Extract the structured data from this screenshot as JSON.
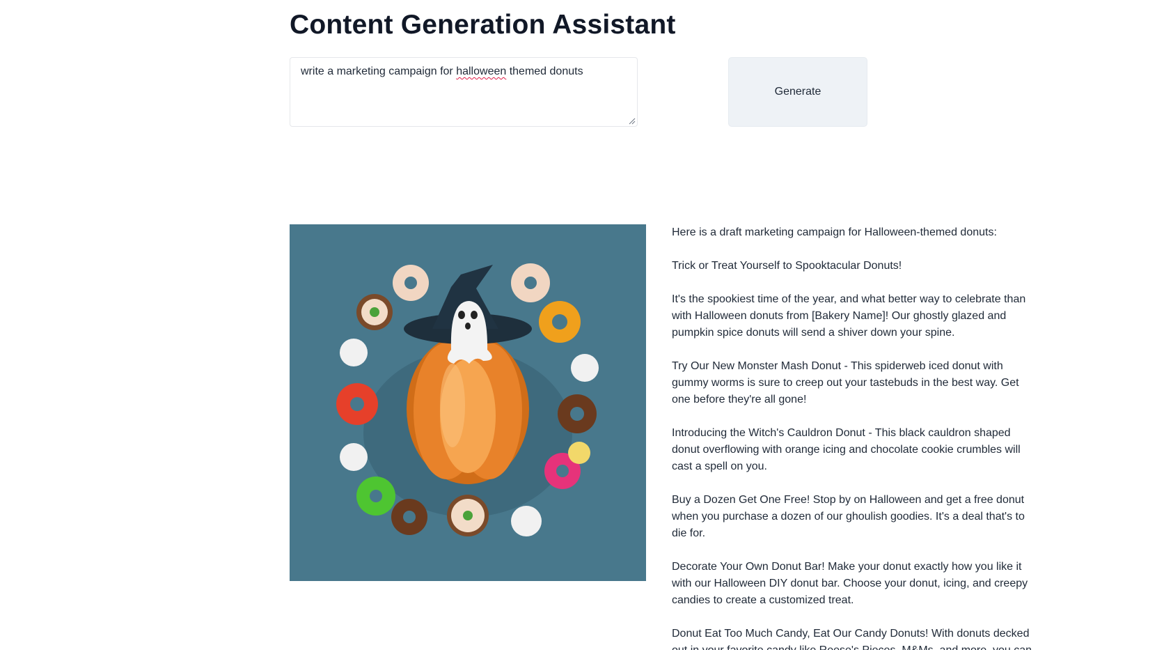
{
  "header": {
    "title": "Content Generation Assistant"
  },
  "prompt": {
    "text_before": "write a marketing campaign for ",
    "misspelled_word": "halloween",
    "text_after": " themed donuts"
  },
  "generate_button": {
    "label": "Generate"
  },
  "colors": {
    "image_background": "#48788c",
    "button_background": "#eef2f6",
    "spellcheck_underline": "#e11d48"
  },
  "response": {
    "paragraphs": [
      "Here is a draft marketing campaign for Halloween-themed donuts:",
      "Trick or Treat Yourself to Spooktacular Donuts!",
      "It's the spookiest time of the year, and what better way to celebrate than with Halloween donuts from [Bakery Name]! Our ghostly glazed and pumpkin spice donuts will send a shiver down your spine.",
      "Try Our New Monster Mash Donut - This spiderweb iced donut with gummy worms is sure to creep out your tastebuds in the best way. Get one before they're all gone!",
      "Introducing the Witch's Cauldron Donut - This black cauldron shaped donut overflowing with orange icing and chocolate cookie crumbles will cast a spell on you.",
      "Buy a Dozen Get One Free! Stop by on Halloween and get a free donut when you purchase a dozen of our ghoulish goodies. It's a deal that's to die for.",
      "Decorate Your Own Donut Bar! Make your donut exactly how you like it with our Halloween DIY donut bar. Choose your donut, icing, and creepy candies to create a customized treat.",
      "Donut Eat Too Much Candy, Eat Our Candy Donuts! With donuts decked out in your favorite candy like Reese's Pieces, M&Ms, and more, you can"
    ]
  }
}
